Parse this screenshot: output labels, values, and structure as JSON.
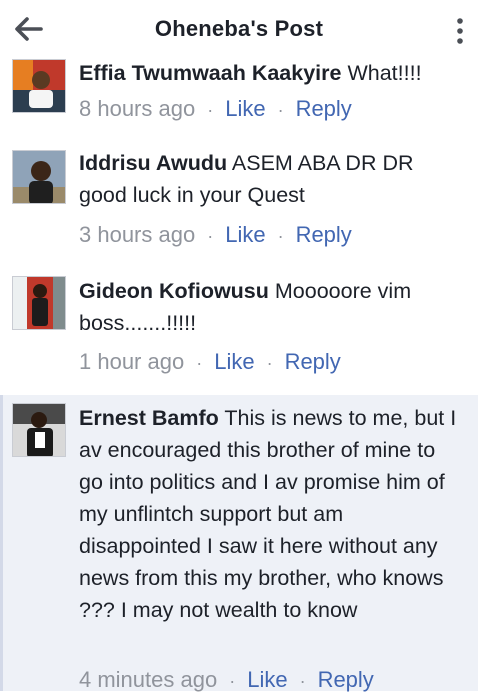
{
  "header": {
    "title": "Oheneba's Post",
    "back_icon": "arrow-left-icon",
    "menu_icon": "kebab-menu-icon"
  },
  "colors": {
    "link": "#4267b2",
    "meta": "#90949c",
    "text": "#1d2129",
    "highlight_bg": "#eef1f7"
  },
  "actions": {
    "like": "Like",
    "reply": "Reply",
    "separator": "·"
  },
  "comments": [
    {
      "author": "Effia Twumwaah Kaakyire",
      "text": "What!!!!",
      "time": "8 hours ago"
    },
    {
      "author": "Iddrisu Awudu",
      "text": "ASEM ABA DR DR good luck in your Quest",
      "time": "3 hours ago"
    },
    {
      "author": "Gideon Kofiowusu",
      "text": "Mooooore vim boss.......!!!!!",
      "time": "1 hour ago"
    },
    {
      "author": "Ernest Bamfo",
      "text": "This is news to me, but I av encouraged this brother of mine to go into politics and I av promise him of my unflintch support but am disappointed I saw it here without any news from this my brother, who knows ??? I may not wealth to know",
      "time": "4 minutes ago"
    }
  ]
}
